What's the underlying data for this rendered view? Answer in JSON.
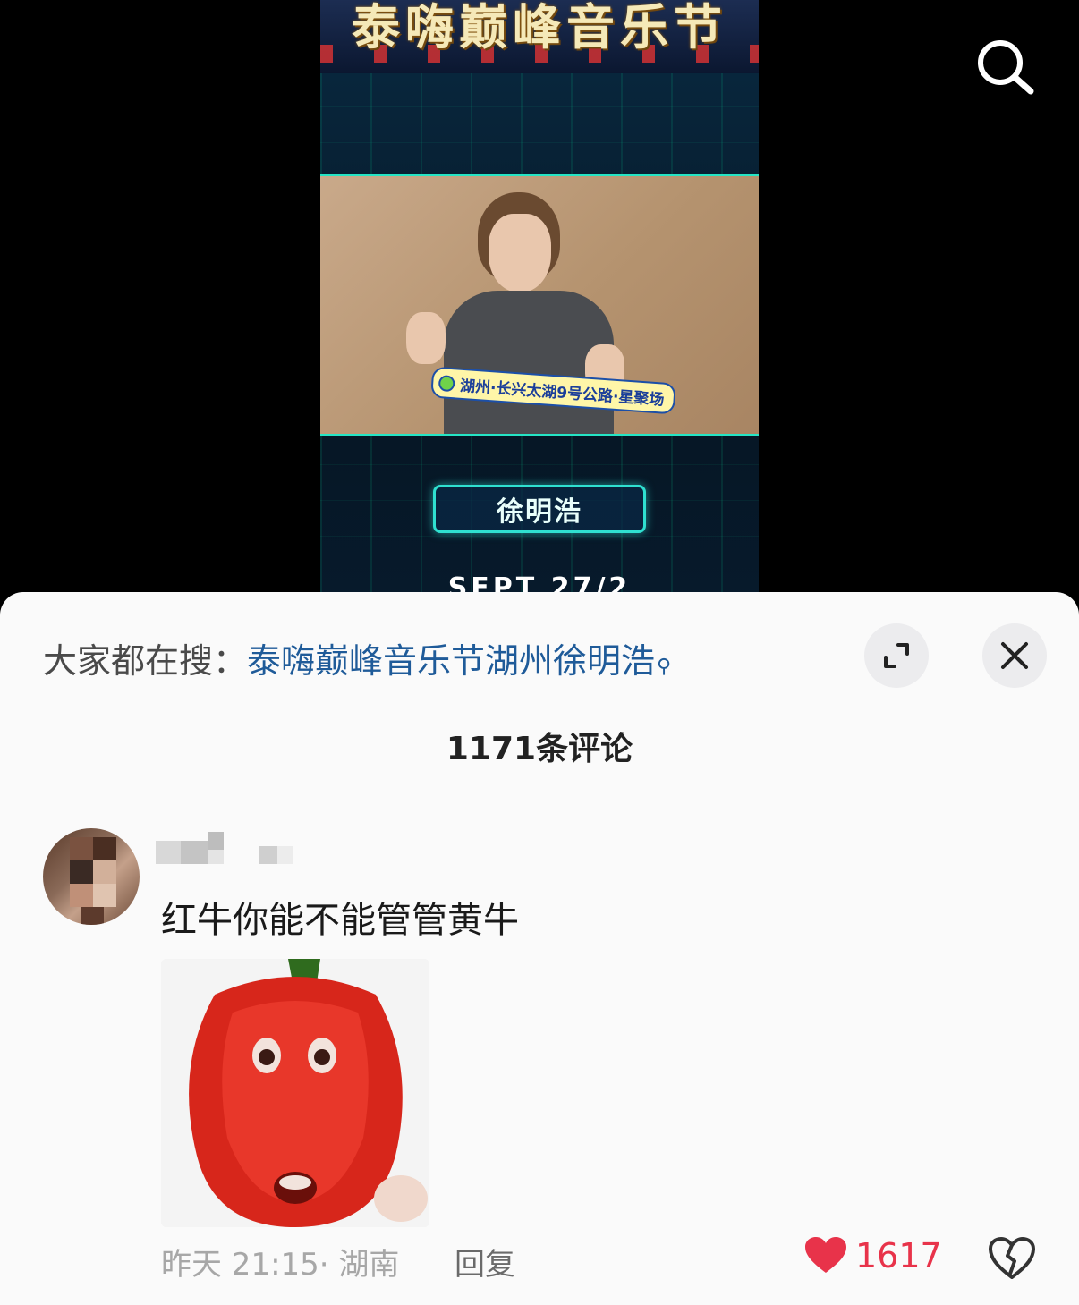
{
  "video": {
    "top_title": "泰嗨巅峰音乐节",
    "location_tag": "湖州·长兴太湖9号公路·星聚场",
    "artist_name": "徐明浩",
    "bottom_text": "SEPT 27/2"
  },
  "sheet": {
    "suggest_prefix": "大家都在搜：",
    "suggest_query": "泰嗨巅峰音乐节湖州徐明浩",
    "comment_count": "1171条评论"
  },
  "comment": {
    "text": "红牛你能不能管管黄牛",
    "time": "昨天 21:15",
    "region": "· 湖南",
    "reply_label": "回复",
    "like_count": "1617"
  },
  "icons": {
    "search": "search-icon",
    "expand": "expand-icon",
    "close": "close-icon",
    "like": "heart-icon",
    "dislike": "broken-heart-icon"
  },
  "colors": {
    "accent_link": "#1f5b99",
    "like_red": "#e8334a",
    "video_frame": "#25e5c5"
  }
}
